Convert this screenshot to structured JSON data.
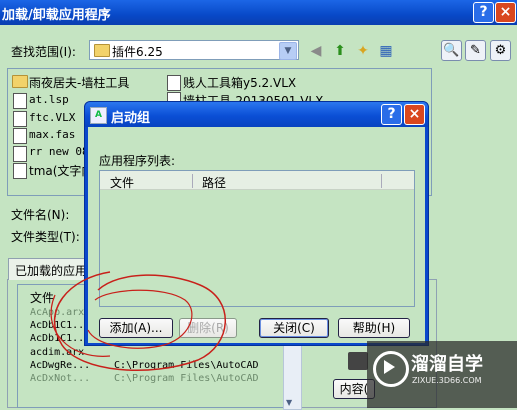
{
  "back_window": {
    "title": "加载/卸载应用程序",
    "lookin_label": "查找范围(I):",
    "lookin_value": "插件6.25",
    "filename_label": "文件名(N):",
    "filetype_label": "文件类型(T):",
    "loaded_tab": "已加载的应用",
    "loaded_col_file": "文件",
    "contents_button": "内容(",
    "files_left": [
      "雨夜居夫-墙柱工具",
      "at.lsp",
      "ftc.VLX",
      "max.fas",
      "rr new 08",
      "tma(文字内"
    ],
    "files_right": [
      "贱人工具箱y5.2.VLX",
      "墙柱工具-20130501.VLX"
    ],
    "loaded_rows": [
      {
        "name": "AcApp.arx",
        "path": ""
      },
      {
        "name": "AcDb1C1...",
        "path": ""
      },
      {
        "name": "AcDb1C1...",
        "path": ""
      },
      {
        "name": "acdim.arx",
        "path": ""
      },
      {
        "name": "AcDwgRe...",
        "path": "C:\\Program Files\\AutoCAD"
      },
      {
        "name": "AcDxNot...",
        "path": "C:\\Program Files\\AutoCAD"
      }
    ],
    "help_glyph": "?",
    "close_glyph": "×"
  },
  "dialog": {
    "title": "启动组",
    "list_label": "应用程序列表:",
    "col_file": "文件",
    "col_path": "路径",
    "btn_add": "添加(A)...",
    "btn_remove": "删除(R)",
    "btn_close": "关闭(C)",
    "btn_help": "帮助(H)",
    "help_glyph": "?",
    "close_glyph": "×"
  },
  "watermark": {
    "text": "溜溜自学",
    "sub": "ZIXUE.3D66.COM"
  },
  "colors": {
    "window_bg": "#c5e4c2",
    "titlebar": "#0a48cc",
    "close_red": "#d9471f",
    "scribble": "#c8201a"
  }
}
